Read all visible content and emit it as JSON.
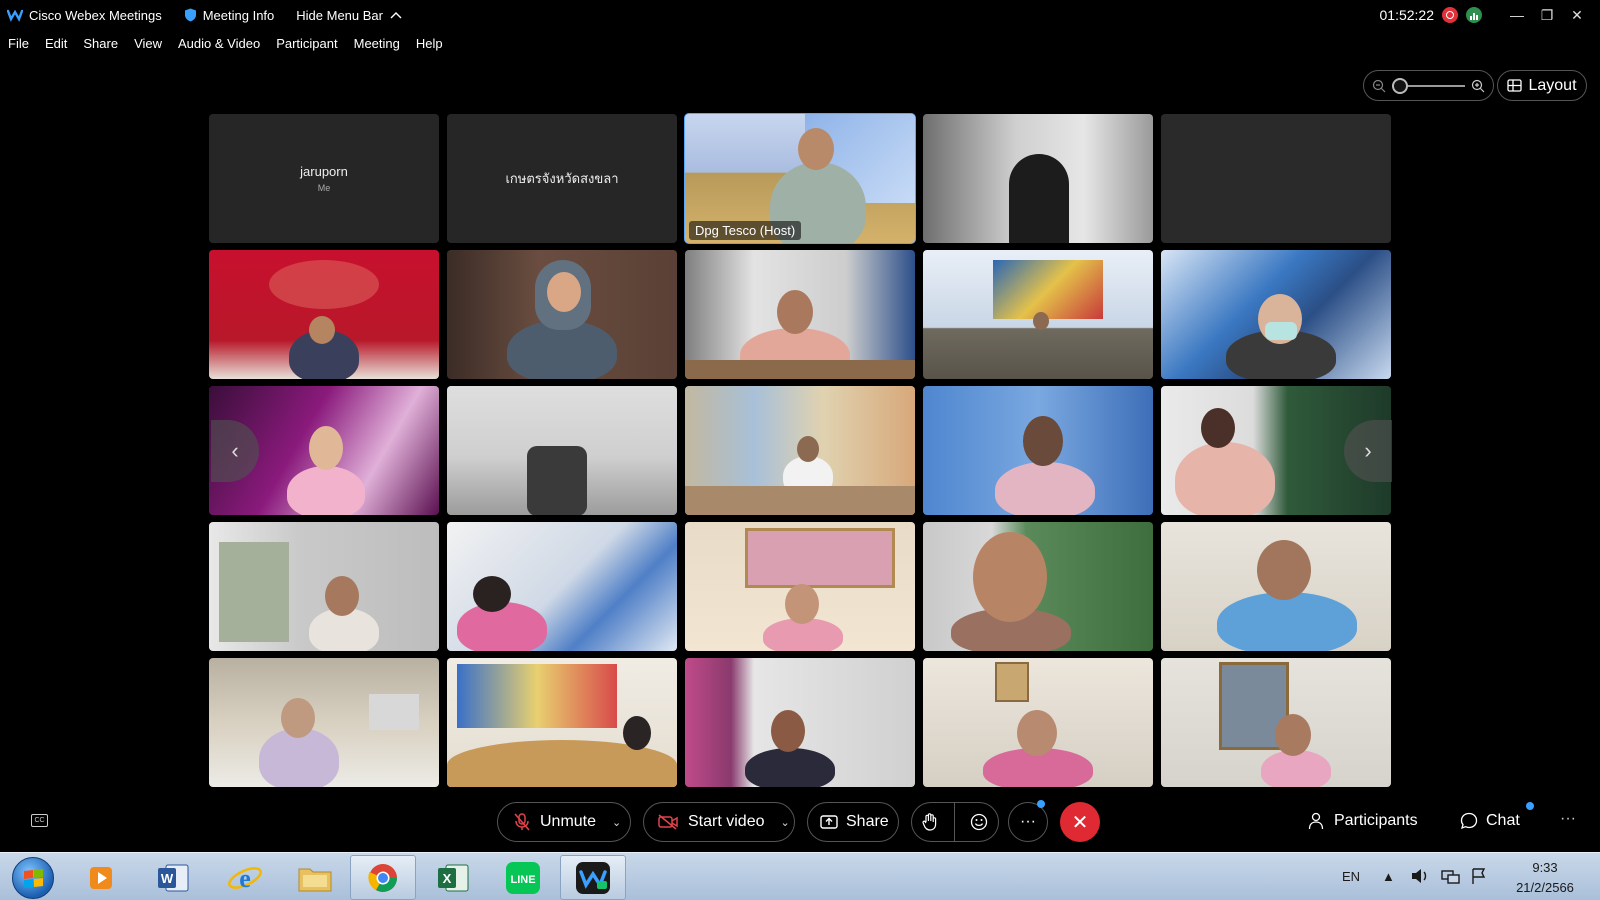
{
  "titlebar": {
    "app_title": "Cisco Webex Meetings",
    "meeting_info": "Meeting Info",
    "hide_menu": "Hide Menu Bar",
    "clock": "01:52:22"
  },
  "menu": {
    "items": [
      "File",
      "Edit",
      "Share",
      "View",
      "Audio & Video",
      "Participant",
      "Meeting",
      "Help"
    ]
  },
  "toolbar_top": {
    "layout_label": "Layout"
  },
  "tiles": {
    "self_name": "jaruporn",
    "self_sub": "Me",
    "guest_name": "เกษตรจังหวัดสงขลา",
    "host_label": "Dpg Tesco (Host)"
  },
  "controls": {
    "unmute": "Unmute",
    "start_video": "Start video",
    "share": "Share",
    "participants": "Participants",
    "chat": "Chat"
  },
  "taskbar": {
    "lang": "EN",
    "time": "9:33",
    "date": "21/2/2566"
  },
  "colors": {
    "accent_blue": "#3aa0ff",
    "end_red": "#e02a33",
    "host_outline": "#5aa7ff"
  }
}
